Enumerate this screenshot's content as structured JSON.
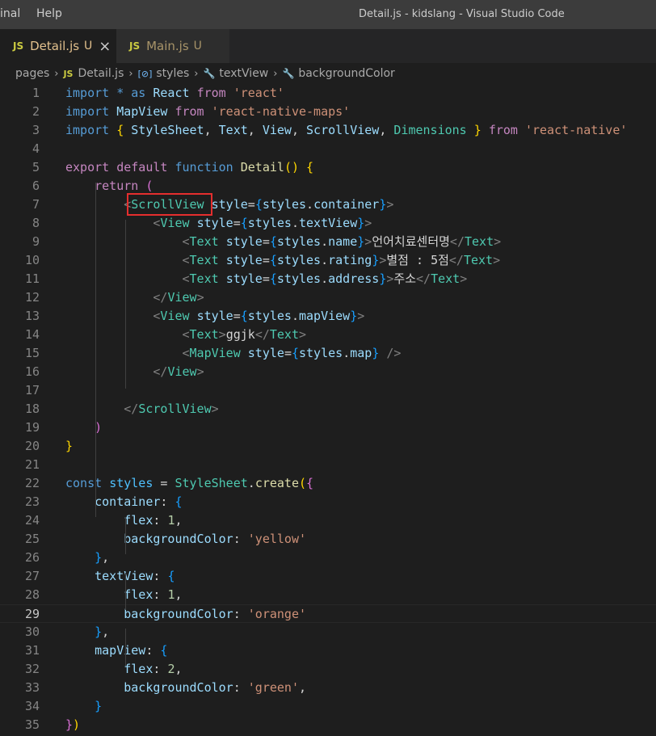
{
  "menu": {
    "terminal": "inal",
    "help": "Help"
  },
  "window_title": "Detail.js - kidslang - Visual Studio Code",
  "tabs": [
    {
      "icon": "JS",
      "name": "Detail.js",
      "status": "U",
      "close": "×"
    },
    {
      "icon": "JS",
      "name": "Main.js",
      "status": "U"
    }
  ],
  "breadcrumb": {
    "items": [
      "pages",
      "Detail.js",
      "styles",
      "textView",
      "backgroundColor"
    ],
    "js_icon": "JS",
    "var_icon": "[⊘]",
    "prop_icon": "🔧"
  },
  "editor": {
    "current_line": 29,
    "lines": [
      {
        "n": "1",
        "t": [
          [
            "kw",
            "import"
          ],
          [
            "pl",
            " "
          ],
          [
            "kw",
            "*"
          ],
          [
            "pl",
            " "
          ],
          [
            "kw",
            "as"
          ],
          [
            "pl",
            " "
          ],
          [
            "var",
            "React"
          ],
          [
            "pl",
            " "
          ],
          [
            "ctrl",
            "from"
          ],
          [
            "pl",
            " "
          ],
          [
            "str",
            "'react'"
          ]
        ]
      },
      {
        "n": "2",
        "t": [
          [
            "kw",
            "import"
          ],
          [
            "pl",
            " "
          ],
          [
            "var",
            "MapView"
          ],
          [
            "pl",
            " "
          ],
          [
            "ctrl",
            "from"
          ],
          [
            "pl",
            " "
          ],
          [
            "str",
            "'react-native-maps'"
          ]
        ]
      },
      {
        "n": "3",
        "t": [
          [
            "kw",
            "import"
          ],
          [
            "pl",
            " "
          ],
          [
            "br1",
            "{"
          ],
          [
            "pl",
            " "
          ],
          [
            "var",
            "StyleSheet"
          ],
          [
            "pl",
            ", "
          ],
          [
            "var",
            "Text"
          ],
          [
            "pl",
            ", "
          ],
          [
            "var",
            "View"
          ],
          [
            "pl",
            ", "
          ],
          [
            "var",
            "ScrollView"
          ],
          [
            "pl",
            ", "
          ],
          [
            "cls",
            "Dimensions"
          ],
          [
            "pl",
            " "
          ],
          [
            "br1",
            "}"
          ],
          [
            "pl",
            " "
          ],
          [
            "ctrl",
            "from"
          ],
          [
            "pl",
            " "
          ],
          [
            "str",
            "'react-native'"
          ]
        ]
      },
      {
        "n": "4",
        "t": []
      },
      {
        "n": "5",
        "t": [
          [
            "ctrl",
            "export"
          ],
          [
            "pl",
            " "
          ],
          [
            "ctrl",
            "default"
          ],
          [
            "pl",
            " "
          ],
          [
            "kw",
            "function"
          ],
          [
            "pl",
            " "
          ],
          [
            "fn",
            "Detail"
          ],
          [
            "br1",
            "()"
          ],
          [
            "pl",
            " "
          ],
          [
            "br1",
            "{"
          ]
        ]
      },
      {
        "n": "6",
        "t": [
          [
            "pl",
            "    "
          ],
          [
            "ctrl",
            "return"
          ],
          [
            "pl",
            " "
          ],
          [
            "br2",
            "("
          ]
        ]
      },
      {
        "n": "7",
        "t": [
          [
            "pl",
            "        "
          ],
          [
            "tag",
            "<"
          ],
          [
            "cls",
            "ScrollView"
          ],
          [
            "pl",
            " "
          ],
          [
            "var",
            "style"
          ],
          [
            "pl",
            "="
          ],
          [
            "br3",
            "{"
          ],
          [
            "var",
            "styles"
          ],
          [
            "pl",
            "."
          ],
          [
            "var",
            "container"
          ],
          [
            "br3",
            "}"
          ],
          [
            "tag",
            ">"
          ]
        ]
      },
      {
        "n": "8",
        "t": [
          [
            "pl",
            "            "
          ],
          [
            "tag",
            "<"
          ],
          [
            "cls",
            "View"
          ],
          [
            "pl",
            " "
          ],
          [
            "var",
            "style"
          ],
          [
            "pl",
            "="
          ],
          [
            "br3",
            "{"
          ],
          [
            "var",
            "styles"
          ],
          [
            "pl",
            "."
          ],
          [
            "var",
            "textView"
          ],
          [
            "br3",
            "}"
          ],
          [
            "tag",
            ">"
          ]
        ]
      },
      {
        "n": "9",
        "t": [
          [
            "pl",
            "                "
          ],
          [
            "tag",
            "<"
          ],
          [
            "cls",
            "Text"
          ],
          [
            "pl",
            " "
          ],
          [
            "var",
            "style"
          ],
          [
            "pl",
            "="
          ],
          [
            "br3",
            "{"
          ],
          [
            "var",
            "styles"
          ],
          [
            "pl",
            "."
          ],
          [
            "var",
            "name"
          ],
          [
            "br3",
            "}"
          ],
          [
            "tag",
            ">"
          ],
          [
            "pl",
            "언어치료센터명"
          ],
          [
            "tag",
            "</"
          ],
          [
            "cls",
            "Text"
          ],
          [
            "tag",
            ">"
          ]
        ]
      },
      {
        "n": "10",
        "t": [
          [
            "pl",
            "                "
          ],
          [
            "tag",
            "<"
          ],
          [
            "cls",
            "Text"
          ],
          [
            "pl",
            " "
          ],
          [
            "var",
            "style"
          ],
          [
            "pl",
            "="
          ],
          [
            "br3",
            "{"
          ],
          [
            "var",
            "styles"
          ],
          [
            "pl",
            "."
          ],
          [
            "var",
            "rating"
          ],
          [
            "br3",
            "}"
          ],
          [
            "tag",
            ">"
          ],
          [
            "pl",
            "별점 : 5점"
          ],
          [
            "tag",
            "</"
          ],
          [
            "cls",
            "Text"
          ],
          [
            "tag",
            ">"
          ]
        ]
      },
      {
        "n": "11",
        "t": [
          [
            "pl",
            "                "
          ],
          [
            "tag",
            "<"
          ],
          [
            "cls",
            "Text"
          ],
          [
            "pl",
            " "
          ],
          [
            "var",
            "style"
          ],
          [
            "pl",
            "="
          ],
          [
            "br3",
            "{"
          ],
          [
            "var",
            "styles"
          ],
          [
            "pl",
            "."
          ],
          [
            "var",
            "address"
          ],
          [
            "br3",
            "}"
          ],
          [
            "tag",
            ">"
          ],
          [
            "pl",
            "주소"
          ],
          [
            "tag",
            "</"
          ],
          [
            "cls",
            "Text"
          ],
          [
            "tag",
            ">"
          ]
        ]
      },
      {
        "n": "12",
        "t": [
          [
            "pl",
            "            "
          ],
          [
            "tag",
            "</"
          ],
          [
            "cls",
            "View"
          ],
          [
            "tag",
            ">"
          ]
        ]
      },
      {
        "n": "13",
        "t": [
          [
            "pl",
            "            "
          ],
          [
            "tag",
            "<"
          ],
          [
            "cls",
            "View"
          ],
          [
            "pl",
            " "
          ],
          [
            "var",
            "style"
          ],
          [
            "pl",
            "="
          ],
          [
            "br3",
            "{"
          ],
          [
            "var",
            "styles"
          ],
          [
            "pl",
            "."
          ],
          [
            "var",
            "mapView"
          ],
          [
            "br3",
            "}"
          ],
          [
            "tag",
            ">"
          ]
        ]
      },
      {
        "n": "14",
        "t": [
          [
            "pl",
            "                "
          ],
          [
            "tag",
            "<"
          ],
          [
            "cls",
            "Text"
          ],
          [
            "tag",
            ">"
          ],
          [
            "pl",
            "ggjk"
          ],
          [
            "tag",
            "</"
          ],
          [
            "cls",
            "Text"
          ],
          [
            "tag",
            ">"
          ]
        ]
      },
      {
        "n": "15",
        "t": [
          [
            "pl",
            "                "
          ],
          [
            "tag",
            "<"
          ],
          [
            "cls",
            "MapView"
          ],
          [
            "pl",
            " "
          ],
          [
            "var",
            "style"
          ],
          [
            "pl",
            "="
          ],
          [
            "br3",
            "{"
          ],
          [
            "var",
            "styles"
          ],
          [
            "pl",
            "."
          ],
          [
            "var",
            "map"
          ],
          [
            "br3",
            "}"
          ],
          [
            "pl",
            " "
          ],
          [
            "tag",
            "/>"
          ]
        ]
      },
      {
        "n": "16",
        "t": [
          [
            "pl",
            "            "
          ],
          [
            "tag",
            "</"
          ],
          [
            "cls",
            "View"
          ],
          [
            "tag",
            ">"
          ]
        ]
      },
      {
        "n": "17",
        "t": []
      },
      {
        "n": "18",
        "t": [
          [
            "pl",
            "        "
          ],
          [
            "tag",
            "</"
          ],
          [
            "cls",
            "ScrollView"
          ],
          [
            "tag",
            ">"
          ]
        ]
      },
      {
        "n": "19",
        "t": [
          [
            "pl",
            "    "
          ],
          [
            "br2",
            ")"
          ]
        ]
      },
      {
        "n": "20",
        "t": [
          [
            "br1",
            "}"
          ]
        ]
      },
      {
        "n": "21",
        "t": []
      },
      {
        "n": "22",
        "t": [
          [
            "kw",
            "const"
          ],
          [
            "pl",
            " "
          ],
          [
            "const",
            "styles"
          ],
          [
            "pl",
            " = "
          ],
          [
            "cls",
            "StyleSheet"
          ],
          [
            "pl",
            "."
          ],
          [
            "fn",
            "create"
          ],
          [
            "br1",
            "("
          ],
          [
            "br2",
            "{"
          ]
        ]
      },
      {
        "n": "23",
        "t": [
          [
            "pl",
            "    "
          ],
          [
            "var",
            "container"
          ],
          [
            "pl",
            ": "
          ],
          [
            "br3",
            "{"
          ]
        ]
      },
      {
        "n": "24",
        "t": [
          [
            "pl",
            "        "
          ],
          [
            "var",
            "flex"
          ],
          [
            "pl",
            ": "
          ],
          [
            "num",
            "1"
          ],
          [
            "pl",
            ","
          ]
        ]
      },
      {
        "n": "25",
        "t": [
          [
            "pl",
            "        "
          ],
          [
            "var",
            "backgroundColor"
          ],
          [
            "pl",
            ": "
          ],
          [
            "str",
            "'yellow'"
          ]
        ]
      },
      {
        "n": "26",
        "t": [
          [
            "pl",
            "    "
          ],
          [
            "br3",
            "}"
          ],
          [
            "pl",
            ","
          ]
        ]
      },
      {
        "n": "27",
        "t": [
          [
            "pl",
            "    "
          ],
          [
            "var",
            "textView"
          ],
          [
            "pl",
            ": "
          ],
          [
            "br3",
            "{"
          ]
        ]
      },
      {
        "n": "28",
        "t": [
          [
            "pl",
            "        "
          ],
          [
            "var",
            "flex"
          ],
          [
            "pl",
            ": "
          ],
          [
            "num",
            "1"
          ],
          [
            "pl",
            ","
          ]
        ]
      },
      {
        "n": "29",
        "t": [
          [
            "pl",
            "        "
          ],
          [
            "var",
            "backgroundColor"
          ],
          [
            "pl",
            ": "
          ],
          [
            "str",
            "'orange'"
          ]
        ]
      },
      {
        "n": "30",
        "t": [
          [
            "pl",
            "    "
          ],
          [
            "br3",
            "}"
          ],
          [
            "pl",
            ","
          ]
        ]
      },
      {
        "n": "31",
        "t": [
          [
            "pl",
            "    "
          ],
          [
            "var",
            "mapView"
          ],
          [
            "pl",
            ": "
          ],
          [
            "br3",
            "{"
          ]
        ]
      },
      {
        "n": "32",
        "t": [
          [
            "pl",
            "        "
          ],
          [
            "var",
            "flex"
          ],
          [
            "pl",
            ": "
          ],
          [
            "num",
            "2"
          ],
          [
            "pl",
            ","
          ]
        ]
      },
      {
        "n": "33",
        "t": [
          [
            "pl",
            "        "
          ],
          [
            "var",
            "backgroundColor"
          ],
          [
            "pl",
            ": "
          ],
          [
            "str",
            "'green'"
          ],
          [
            "pl",
            ","
          ]
        ]
      },
      {
        "n": "34",
        "t": [
          [
            "pl",
            "    "
          ],
          [
            "br3",
            "}"
          ]
        ]
      },
      {
        "n": "35",
        "t": [
          [
            "br2",
            "}"
          ],
          [
            "br1",
            ")"
          ]
        ]
      }
    ]
  },
  "colors": {
    "keyword": "#569cd6",
    "control": "#c586c0",
    "string": "#ce9178",
    "variable": "#9cdcfe",
    "component": "#4ec9b0",
    "highlight_box": "#e52e2e",
    "untracked": "#e2c08d"
  }
}
